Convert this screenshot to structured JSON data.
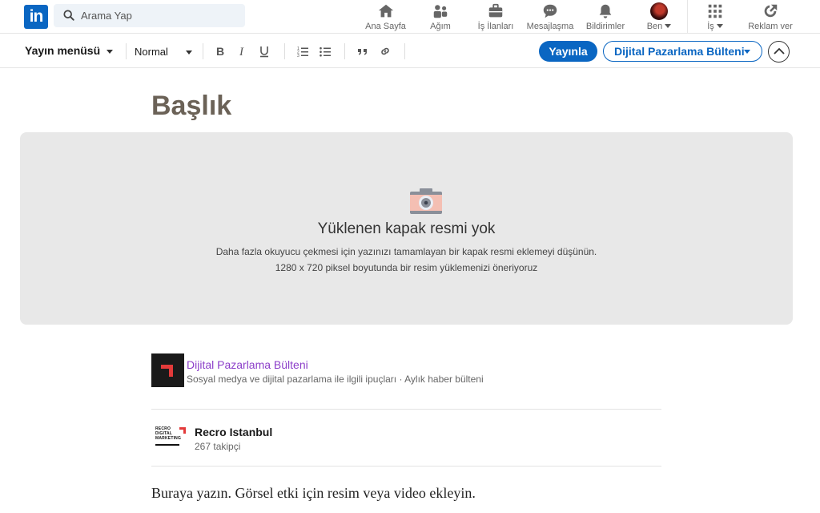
{
  "nav": {
    "logo_text": "in",
    "search_placeholder": "Arama Yap",
    "items": [
      {
        "label": "Ana Sayfa",
        "icon": "home-icon"
      },
      {
        "label": "Ağım",
        "icon": "network-icon"
      },
      {
        "label": "İş İlanları",
        "icon": "briefcase-icon"
      },
      {
        "label": "Mesajlaşma",
        "icon": "messaging-icon"
      },
      {
        "label": "Bildirimler",
        "icon": "bell-icon"
      },
      {
        "label": "Ben",
        "icon": "avatar"
      },
      {
        "label": "İş",
        "icon": "grid-icon"
      },
      {
        "label": "Reklam ver",
        "icon": "compass-icon"
      }
    ]
  },
  "toolbar": {
    "menu_label": "Yayın menüsü",
    "style_value": "Normal",
    "publish_label": "Yayınla",
    "newsletter_label": "Dijital Pazarlama Bülteni"
  },
  "editor": {
    "title_placeholder": "Başlık",
    "cover": {
      "heading": "Yüklenen kapak resmi yok",
      "desc_line1": "Daha fazla okuyucu çekmesi için yazınızı tamamlayan bir kapak resmi eklemeyi düşünün.",
      "desc_line2": "1280 x 720 piksel boyutunda bir resim yüklemenizi öneriyoruz"
    },
    "newsletter": {
      "name": "Dijital Pazarlama Bülteni",
      "description": "Sosyal medya ve dijital pazarlama ile ilgili ipuçları",
      "frequency": "Aylık haber bülteni"
    },
    "organization": {
      "logo_lines": [
        "RECRO",
        "DIGITAL",
        "MARKETING"
      ],
      "name": "Recro Istanbul",
      "followers": "267 takipçi"
    },
    "body_placeholder": "Buraya yazın. Görsel etki için resim veya video ekleyin."
  },
  "colors": {
    "brand": "#0a66c2",
    "newsletter_link": "#8c3fc9",
    "title": "#6b6257",
    "cover_bg": "#e8e8e8"
  }
}
